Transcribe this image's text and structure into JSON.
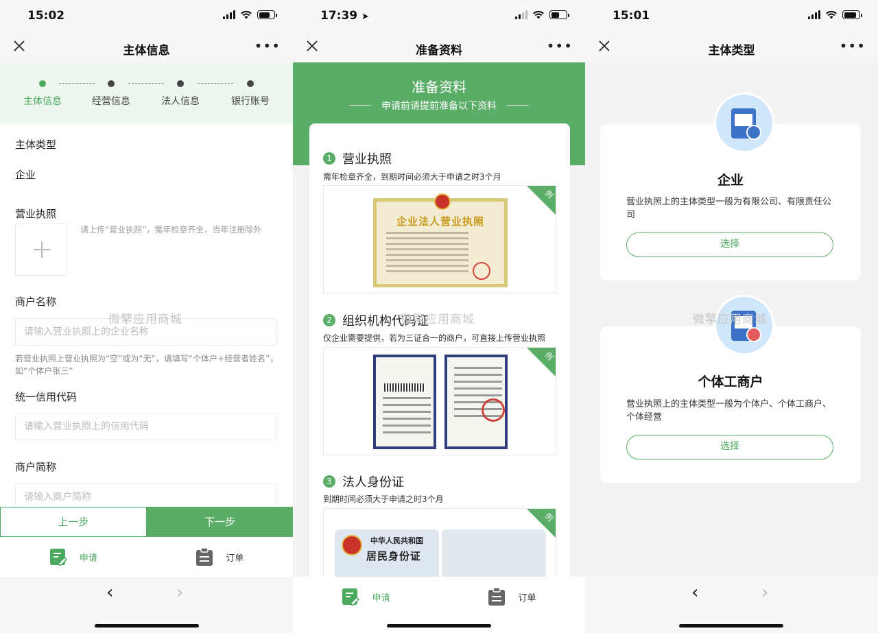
{
  "watermark": "微擎应用商城",
  "phones": [
    {
      "time": "15:02",
      "nav_title": "主体信息",
      "steps": [
        "主体信息",
        "经营信息",
        "法人信息",
        "银行账号"
      ],
      "fields": {
        "subject_type_label": "主体类型",
        "subject_type_value": "企业",
        "license_label": "营业执照",
        "license_hint": "请上传“营业执照”，需年检章齐全，当年注册除外",
        "merchant_name_label": "商户名称",
        "merchant_name_placeholder": "请输入营业执照上的企业名称",
        "merchant_name_note": "若营业执照上营业执照为“空”或为“无”，请填写“个体户+经营者姓名”，如“个体户张三”",
        "credit_code_label": "统一信用代码",
        "credit_code_placeholder": "请输入营业执照上的信用代码",
        "short_name_label": "商户简称",
        "short_name_placeholder": "请输入商户简称"
      },
      "prev_button": "上一步",
      "next_button": "下一步"
    },
    {
      "time": "17:39",
      "nav_title": "准备资料",
      "banner_title": "准备资料",
      "banner_subtitle": "申请前请提前准备以下资料",
      "sections": [
        {
          "num": "1",
          "title": "营业执照",
          "desc": "需年检章齐全，到期时间必须大于申请之时3个月"
        },
        {
          "num": "2",
          "title": "组织机构代码证",
          "desc": "仅企业需要提供，若为三证合一的商户，可直接上传营业执照"
        },
        {
          "num": "3",
          "title": "法人身份证",
          "desc": "到期时间必须大于申请之时3个月"
        }
      ],
      "example_badge": "例",
      "sample_license_title": "企业法人营业执照",
      "sample_id_country": "中华人民共和国",
      "sample_id_title": "居民身份证"
    },
    {
      "time": "15:01",
      "nav_title": "主体类型",
      "types": [
        {
          "name": "企业",
          "desc": "营业执照上的主体类型一般为有限公司、有限责任公司",
          "button": "选择"
        },
        {
          "name": "个体工商户",
          "desc": "营业执照上的主体类型一般为个体户、个体工商户、个体经营",
          "button": "选择"
        }
      ]
    }
  ],
  "tabbar": {
    "apply": "申请",
    "order": "订单"
  },
  "colors": {
    "accent": "#5aad66",
    "accent_text": "#4caa5e"
  }
}
